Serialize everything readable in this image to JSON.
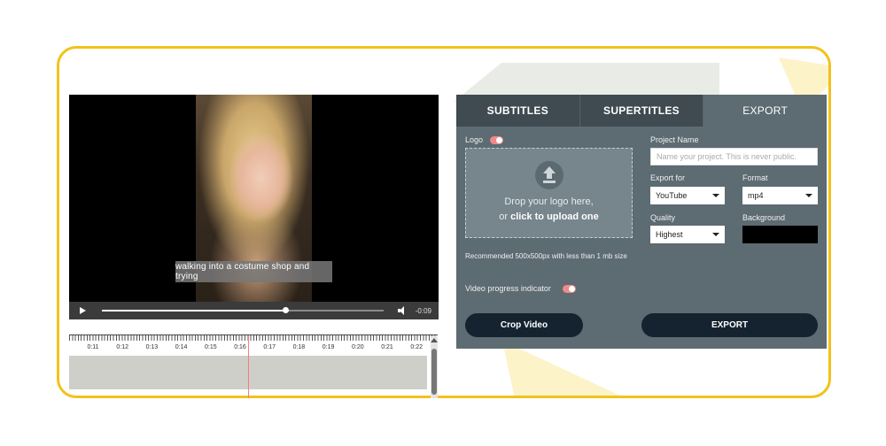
{
  "player": {
    "subtitle_text": "walking into a costume shop and trying",
    "time_remaining": "-0:09",
    "progress_fraction": 0.65
  },
  "timeline": {
    "ticks": [
      "0:11",
      "0:12",
      "0:13",
      "0:14",
      "0:15",
      "0:16",
      "0:17",
      "0:18",
      "0:19",
      "0:20",
      "0:21",
      "0:22"
    ]
  },
  "tabs": [
    {
      "label": "SUBTITLES",
      "active": false
    },
    {
      "label": "SUPERTITLES",
      "active": false
    },
    {
      "label": "EXPORT",
      "active": true
    }
  ],
  "export_panel": {
    "logo_label": "Logo",
    "drop_line1": "Drop your logo here,",
    "drop_or": "or",
    "drop_click": "click to upload one",
    "recommendation": "Recommended 500x500px with less than 1 mb size",
    "progress_indicator_label": "Video progress indicator",
    "project_name_label": "Project Name",
    "project_name_placeholder": "Name your project. This is never public.",
    "export_for_label": "Export for",
    "export_for_value": "YouTube",
    "format_label": "Format",
    "format_value": "mp4",
    "quality_label": "Quality",
    "quality_value": "Highest",
    "background_label": "Background",
    "background_color": "#000000",
    "crop_button": "Crop Video",
    "export_button": "EXPORT"
  },
  "colors": {
    "frame_border": "#f2c21b",
    "panel_bg": "#5d6b72",
    "toggle_accent": "#f08a8a"
  }
}
